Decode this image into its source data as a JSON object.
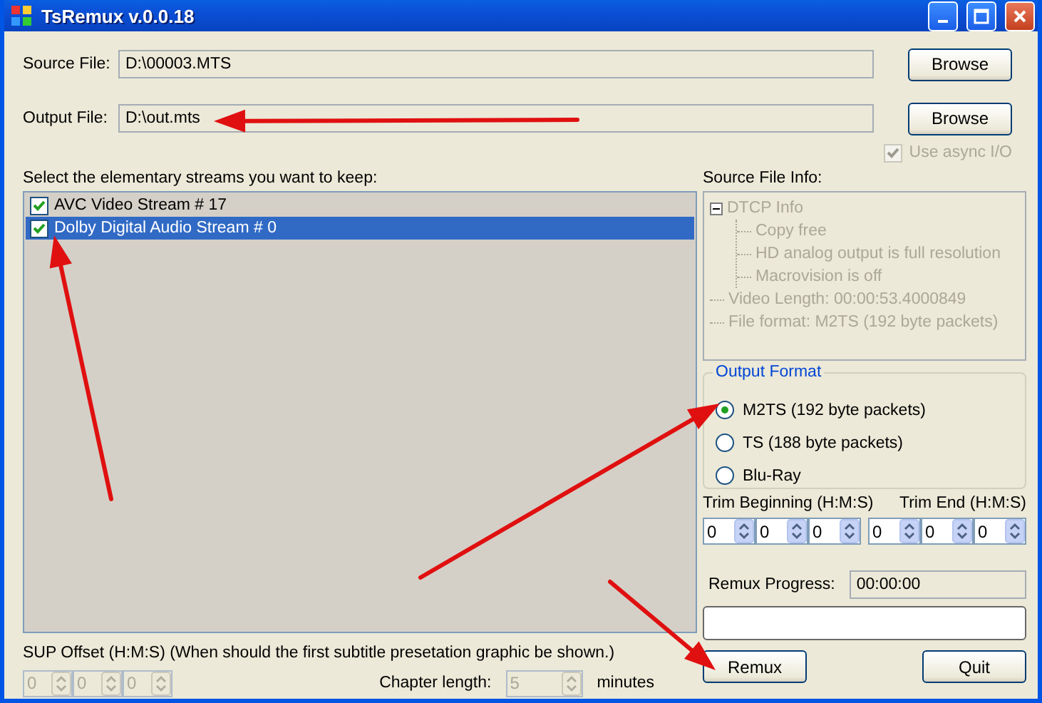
{
  "window": {
    "title": "TsRemux v.0.0.18"
  },
  "source_file": {
    "label": "Source File:",
    "value": "D:\\00003.MTS",
    "button": "Browse"
  },
  "output_file": {
    "label": "Output File:",
    "value": "D:\\out.mts",
    "button": "Browse"
  },
  "async_io": {
    "label": "Use async I/O",
    "checked": true,
    "disabled": true
  },
  "streams": {
    "label": "Select the elementary streams you want to keep:",
    "items": [
      {
        "label": "AVC Video Stream # 17",
        "checked": true,
        "selected": false
      },
      {
        "label": "Dolby Digital Audio Stream # 0",
        "checked": true,
        "selected": true
      }
    ]
  },
  "source_info": {
    "label": "Source File Info:",
    "tree": [
      {
        "label": "DTCP Info",
        "expanded": true,
        "children": [
          {
            "label": "Copy free"
          },
          {
            "label": "HD analog output is full resolution"
          },
          {
            "label": "Macrovision is off"
          }
        ]
      },
      {
        "label": "Video Length: 00:00:53.4000849"
      },
      {
        "label": "File format: M2TS (192 byte packets)"
      }
    ]
  },
  "output_format": {
    "title": "Output Format",
    "options": [
      {
        "label": "M2TS (192 byte packets)",
        "selected": true
      },
      {
        "label": "TS (188 byte packets)",
        "selected": false
      },
      {
        "label": "Blu-Ray",
        "selected": false
      }
    ]
  },
  "trim": {
    "begin_label": "Trim Beginning (H:M:S)",
    "end_label": "Trim End (H:M:S)",
    "begin": [
      "0",
      "0",
      "0"
    ],
    "end": [
      "0",
      "0",
      "0"
    ]
  },
  "remux_progress": {
    "label": "Remux Progress:",
    "time": "00:00:00",
    "level": 0
  },
  "sup_offset": {
    "label": "SUP Offset (H:M:S) (When should the first subtitle presetation graphic be shown.)",
    "values": [
      "0",
      "0",
      "0"
    ],
    "disabled": true
  },
  "chapter_length": {
    "label": "Chapter length:",
    "value": "5",
    "unit": "minutes",
    "disabled": true
  },
  "buttons": {
    "remux": "Remux",
    "quit": "Quit"
  }
}
